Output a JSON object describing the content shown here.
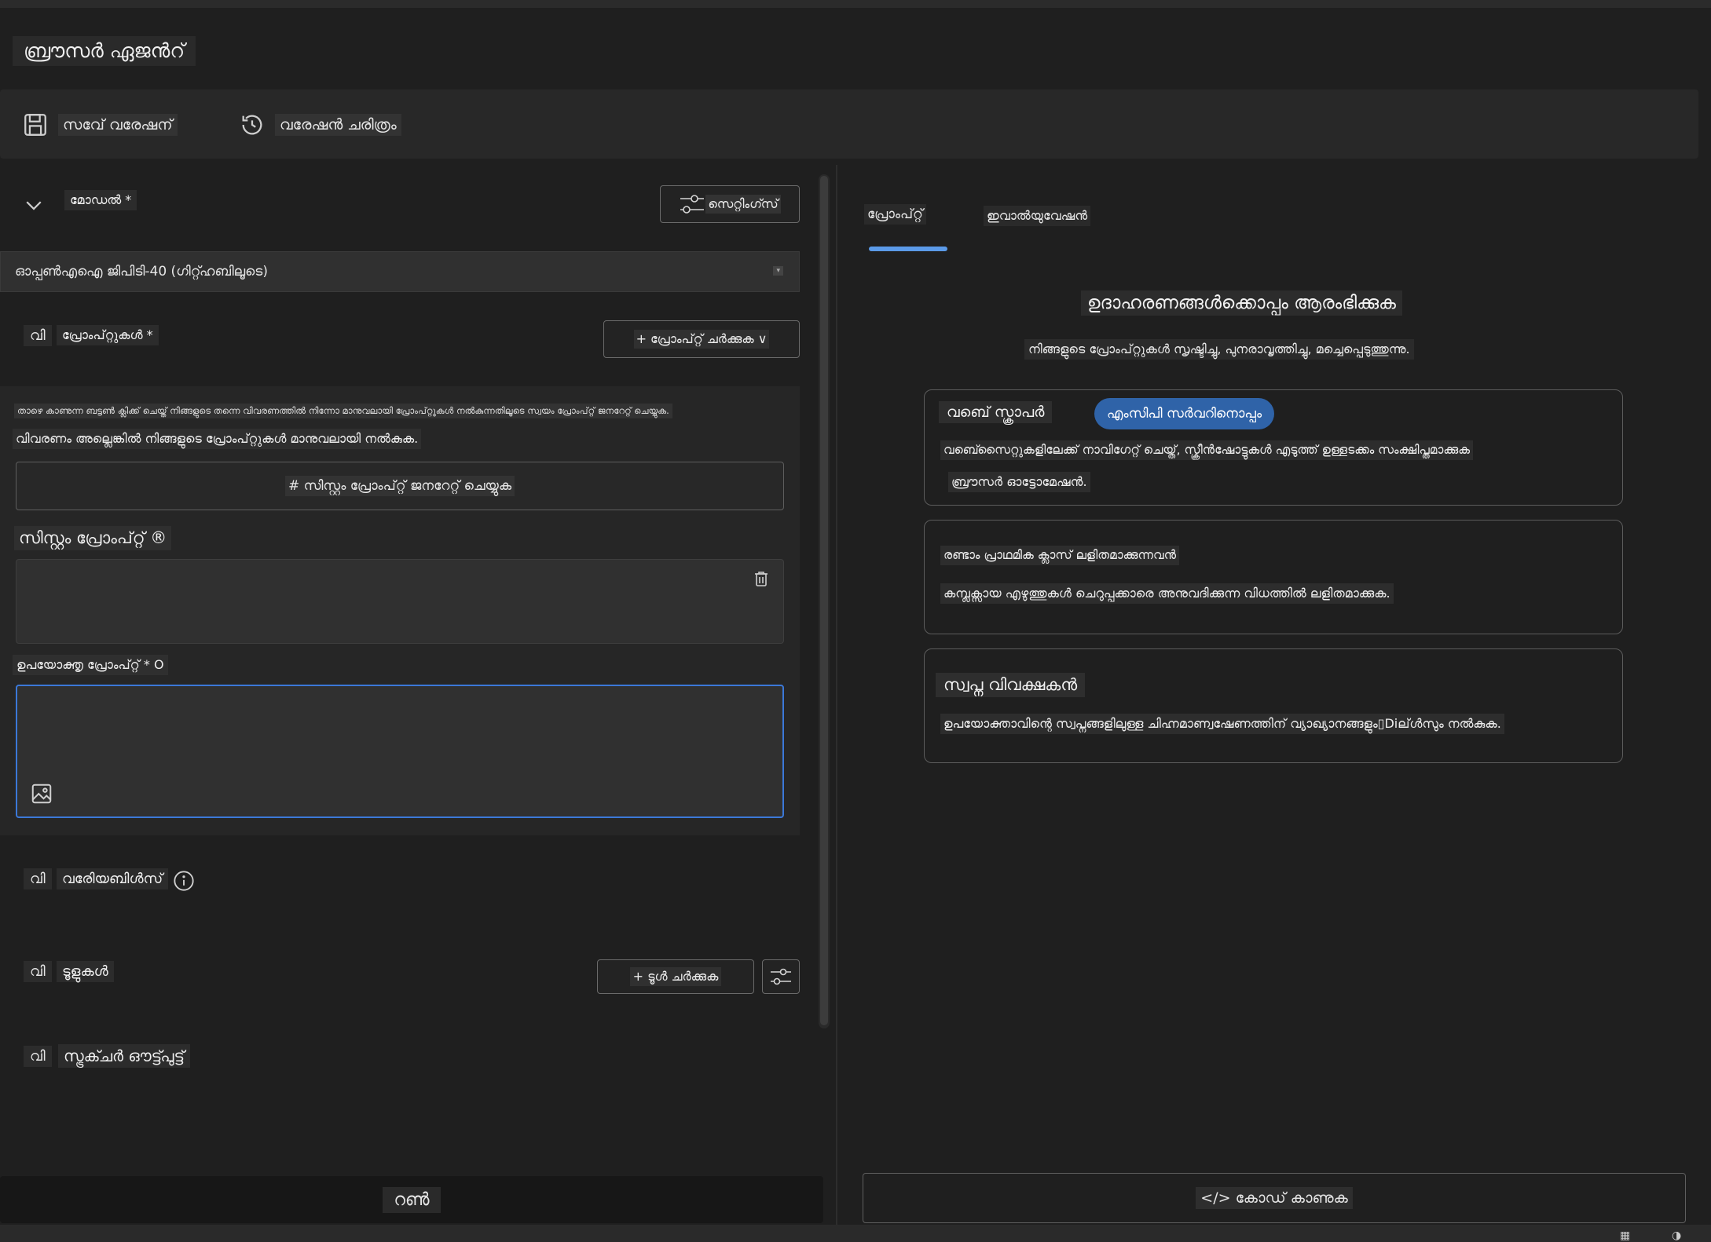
{
  "app": {
    "title": "ബ്രൗസർ ഏജൻറ്"
  },
  "toolbar": {
    "save_label": "സവേ് വരേഷന്",
    "history_label": "വരേഷന്‍ ചരിത്രം"
  },
  "model_section": {
    "label": "മോഡല്‍ *",
    "settings_label": "സെറ്റിംഗ്സ്",
    "selected_model": "ഓപ്പൺഎഐ ജിപിടി-40 (ഗിറ്റ്ഹബിലൂടെ)",
    "caret": "▾"
  },
  "prompts_section": {
    "toggle": "വി",
    "label": "പ്രോംപ്റ്റുകള്‍ *",
    "add_prompt_label": "+ പ്രോംപ്റ്റ് ചര്‍ക്കുക ∨",
    "hint_small": "താഴെ കാണുന്ന ബട്ടൺ ക്ലിക്ക് ചെയ്ത് നിങ്ങളുടെ തന്നെ വിവരണത്തിൽ നിന്നോ മാനുവലായി പ്രോംപ്റ്റുകള്‍ നല്‍കുന്നതിലൂടെ സ്വയം പ്രോംപ്റ്റ് ജനറേറ്റ് ചെയ്യുക.",
    "hint_medium": "വിവരണം അല്ലെങ്കിൽ നിങ്ങളുടെ പ്രോംപ്റ്റുകള്‍ മാനുവലായി നല്‍കുക.",
    "generate_label": "# സിസ്റ്റം പ്രോംപ്റ്റ് ജനറേറ്റ് ചെയ്യുക",
    "system_label": "സിസ്റ്റം പ്രോംപ്റ്റ് ®",
    "system_value": "",
    "user_label": "ഉപയോക്തൃ പ്രോംപ്റ്റ് * O",
    "user_value": ""
  },
  "variables_section": {
    "toggle": "വി",
    "label": "വരേിയബിള്‍സ്"
  },
  "tools_section": {
    "toggle": "വി",
    "label": "ടൂളുകള്‍",
    "add_tool_label": "+ ടൂള്‍ ചര്‍ക്കുക"
  },
  "structured_section": {
    "toggle": "വി",
    "label": "സ്ട്രക്ചര്‍ ഔട്ട്പുട്ട്"
  },
  "run": {
    "label": "റണ്‍"
  },
  "tabs": [
    {
      "label": "പ്രോംപ്റ്റ്",
      "active": true
    },
    {
      "label": "ഇവാല്‍യുവേഷന്‍",
      "active": false
    }
  ],
  "examples": {
    "title": "ഉദാഹരണങ്ങള്‍ക്കൊപ്പം ആരംഭിക്കുക",
    "subtitle": "നിങ്ങളുടെ പ്രോംപ്റ്റുകള്‍ സൃഷ്ടിച്ചു, പുനരാവൃത്തിച്ചു, മച്ചെപ്പെടുത്തുന്നു.",
    "cards": [
      {
        "title": "വബെ് സ്ക്രാപര്‍",
        "pill": "എംസിപി സര്‍വറിനൊപ്പം",
        "line1": "വബെ്സൈറ്റുകളിലേക്ക് നാവിഗേറ്റ് ചെയ്ത്, സ്ക്രീന്‍ഷോട്ടുകള്‍ എടുത്ത് ഉള്ളടക്കം സംക്ഷിപ്തമാക്കുക",
        "line2": "ബ്രൗസര്‍ ഓട്ടോമേഷന്‍."
      },
      {
        "title": "രണ്ടാം പ്രാഥമിക ക്ലാസ് ലളിതമാക്കുന്നവന്‍",
        "line1": "കമ്പ്ലക്സായ എഴുത്തുകള്‍ ചെറുപ്പക്കാരെ അനുവദിക്കുന്ന വിധത്തില്‍ ലളിതമാക്കുക."
      },
      {
        "title": "സ്വപ്ന വിവക്ഷകന്‍",
        "line1": "ഉപയോക്താവിന്റെ സ്വപ്നങ്ങളിലുള്ള ചിഹ്നമാണ്വഷേണത്തിന് വ്യാഖ്യാനങ്ങളും▯Diല്ള്‍സും നല്‍കുക."
      }
    ]
  },
  "code_button": {
    "label": "</> കോഡ് കാണുക"
  },
  "colors": {
    "accent": "#3b78d8",
    "pill": "#2f63a8",
    "tab_underline": "#5b9ae8",
    "background": "#1f1f1f"
  }
}
